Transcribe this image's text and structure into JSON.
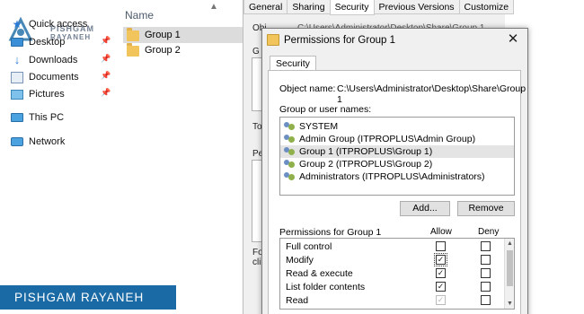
{
  "nav": {
    "items": [
      {
        "label": "Quick access",
        "icon": "star-icon"
      },
      {
        "label": "Desktop",
        "icon": "desktop-icon"
      },
      {
        "label": "Downloads",
        "icon": "downloads-icon"
      },
      {
        "label": "Documents",
        "icon": "documents-icon"
      },
      {
        "label": "Pictures",
        "icon": "pictures-icon"
      },
      {
        "label": "This PC",
        "icon": "this-pc-icon"
      },
      {
        "label": "Network",
        "icon": "network-icon"
      }
    ],
    "logo_line1": "PISHGAM",
    "logo_line2": "RAYANEH"
  },
  "filelist": {
    "column": "Name",
    "rows": [
      {
        "name": "Group 1",
        "selected": true
      },
      {
        "name": "Group 2",
        "selected": false
      }
    ]
  },
  "properties": {
    "tabs": [
      "General",
      "Sharing",
      "Security",
      "Previous Versions",
      "Customize"
    ],
    "active_tab": "Security",
    "fragments": {
      "obj": "Obj",
      "path": "C:\\Users\\Administrator\\Desktop\\Share\\Group 1",
      "g": "G",
      "to": "To",
      "pe": "Pe",
      "fo": "Fo",
      "cli": "cli"
    }
  },
  "dialog": {
    "title": "Permissions for Group 1",
    "tab": "Security",
    "object_label": "Object name:",
    "object_path": "C:\\Users\\Administrator\\Desktop\\Share\\Group 1",
    "group_label": "Group or user names:",
    "groups": [
      {
        "name": "SYSTEM",
        "selected": false
      },
      {
        "name": "Admin Group (ITPROPLUS\\Admin Group)",
        "selected": false
      },
      {
        "name": "Group 1 (ITPROPLUS\\Group 1)",
        "selected": true
      },
      {
        "name": "Group 2 (ITPROPLUS\\Group 2)",
        "selected": false
      },
      {
        "name": "Administrators (ITPROPLUS\\Administrators)",
        "selected": false
      }
    ],
    "add_button": "Add...",
    "remove_button": "Remove",
    "perm_label": "Permissions for Group 1",
    "allow_label": "Allow",
    "deny_label": "Deny",
    "permissions": [
      {
        "name": "Full control",
        "allow": false,
        "deny": false,
        "allow_disabled": false
      },
      {
        "name": "Modify",
        "allow": true,
        "deny": false,
        "allow_disabled": false
      },
      {
        "name": "Read & execute",
        "allow": true,
        "deny": false,
        "allow_disabled": false
      },
      {
        "name": "List folder contents",
        "allow": true,
        "deny": false,
        "allow_disabled": false
      },
      {
        "name": "Read",
        "allow": true,
        "deny": false,
        "allow_disabled": true
      }
    ]
  },
  "banner": "PISHGAM RAYANEH",
  "colors": {
    "banner": "#1a6aa5",
    "selection": "#dcdcdc",
    "folder": "#f2c55c"
  }
}
